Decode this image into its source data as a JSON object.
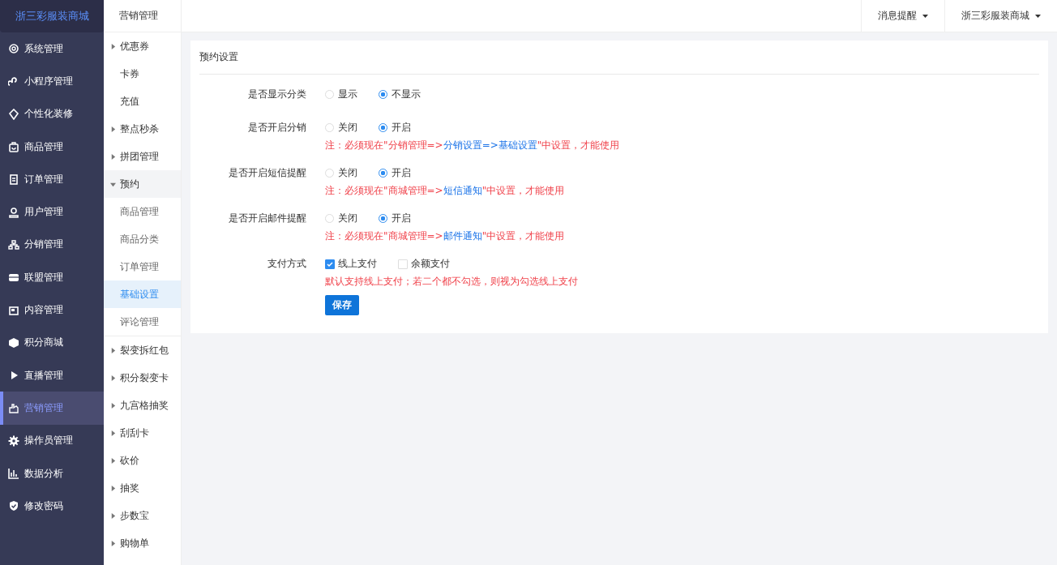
{
  "brand": "浙三彩服装商城",
  "sidebar": {
    "items": [
      {
        "label": "系统管理",
        "selected": false
      },
      {
        "label": "小程序管理",
        "selected": false
      },
      {
        "label": "个性化装修",
        "selected": false
      },
      {
        "label": "商品管理",
        "selected": false
      },
      {
        "label": "订单管理",
        "selected": false
      },
      {
        "label": "用户管理",
        "selected": false
      },
      {
        "label": "分销管理",
        "selected": false
      },
      {
        "label": "联盟管理",
        "selected": false
      },
      {
        "label": "内容管理",
        "selected": false
      },
      {
        "label": "积分商城",
        "selected": false
      },
      {
        "label": "直播管理",
        "selected": false
      },
      {
        "label": "营销管理",
        "selected": true
      },
      {
        "label": "操作员管理",
        "selected": false
      },
      {
        "label": "数据分析",
        "selected": false
      },
      {
        "label": "修改密码",
        "selected": false
      }
    ]
  },
  "submenu": {
    "title": "营销管理",
    "items": [
      {
        "kind": "group",
        "label": "优惠券",
        "expanded": false
      },
      {
        "kind": "leaf",
        "label": "卡券"
      },
      {
        "kind": "leaf",
        "label": "充值"
      },
      {
        "kind": "group",
        "label": "整点秒杀",
        "expanded": false
      },
      {
        "kind": "group",
        "label": "拼团管理",
        "expanded": false
      },
      {
        "kind": "group",
        "label": "预约",
        "expanded": true,
        "children": [
          {
            "label": "商品管理",
            "selected": false
          },
          {
            "label": "商品分类",
            "selected": false
          },
          {
            "label": "订单管理",
            "selected": false
          },
          {
            "label": "基础设置",
            "selected": true
          },
          {
            "label": "评论管理",
            "selected": false
          }
        ]
      },
      {
        "kind": "group",
        "label": "裂变拆红包",
        "expanded": false
      },
      {
        "kind": "group",
        "label": "积分裂变卡",
        "expanded": false
      },
      {
        "kind": "group",
        "label": "九宫格抽奖",
        "expanded": false
      },
      {
        "kind": "group",
        "label": "刮刮卡",
        "expanded": false
      },
      {
        "kind": "group",
        "label": "砍价",
        "expanded": false
      },
      {
        "kind": "group",
        "label": "抽奖",
        "expanded": false
      },
      {
        "kind": "group",
        "label": "步数宝",
        "expanded": false
      },
      {
        "kind": "group",
        "label": "购物单",
        "expanded": false
      }
    ]
  },
  "topbar": {
    "items": [
      {
        "label": "消息提醒"
      },
      {
        "label": "浙三彩服装商城"
      }
    ]
  },
  "form": {
    "title": "预约设置",
    "rows": [
      {
        "kind": "radio",
        "label": "是否显示分类",
        "options": [
          {
            "label": "显示",
            "selected": false
          },
          {
            "label": "不显示",
            "selected": true
          }
        ]
      },
      {
        "kind": "radio",
        "label": "是否开启分销",
        "options": [
          {
            "label": "关闭",
            "selected": false
          },
          {
            "label": "开启",
            "selected": true
          }
        ],
        "note": [
          {
            "text": "注：必须现在\"分销管理=>",
            "highlight": false
          },
          {
            "text": "分销设置=>基础设置",
            "highlight": true
          },
          {
            "text": "\"中设置，才能使用",
            "highlight": false
          }
        ]
      },
      {
        "kind": "radio",
        "label": "是否开启短信提醒",
        "options": [
          {
            "label": "关闭",
            "selected": false
          },
          {
            "label": "开启",
            "selected": true
          }
        ],
        "note": [
          {
            "text": "注：必须现在\"商城管理=>",
            "highlight": false
          },
          {
            "text": "短信通知",
            "highlight": true
          },
          {
            "text": "\"中设置，才能使用",
            "highlight": false
          }
        ]
      },
      {
        "kind": "radio",
        "label": "是否开启邮件提醒",
        "options": [
          {
            "label": "关闭",
            "selected": false
          },
          {
            "label": "开启",
            "selected": true
          }
        ],
        "note": [
          {
            "text": "注：必须现在\"商城管理=>",
            "highlight": false
          },
          {
            "text": "邮件通知",
            "highlight": true
          },
          {
            "text": "\"中设置，才能使用",
            "highlight": false
          }
        ]
      },
      {
        "kind": "checkbox",
        "label": "支付方式",
        "options": [
          {
            "label": "线上支付",
            "checked": true
          },
          {
            "label": "余额支付",
            "checked": false
          }
        ],
        "note": [
          {
            "text": "默认支持线上支付；若二个都不勾选，则视为勾选线上支付",
            "highlight": false
          }
        ]
      }
    ],
    "button": "保存"
  }
}
